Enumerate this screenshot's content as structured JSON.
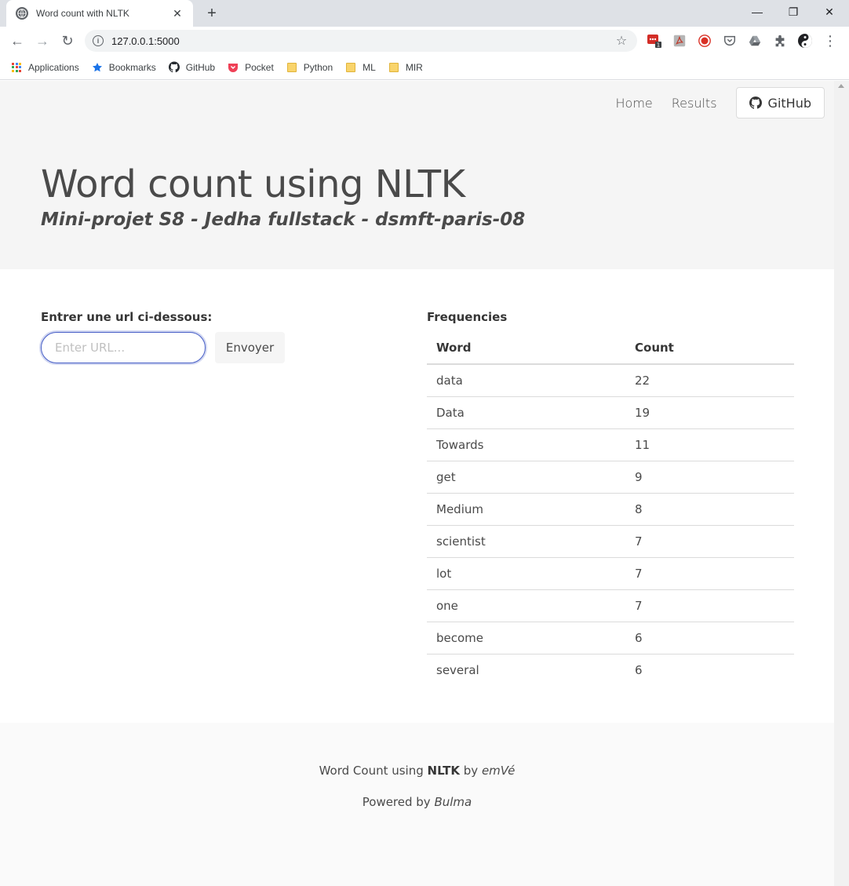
{
  "browser": {
    "tab_title": "Word count with NLTK",
    "tab_close": "✕",
    "new_tab": "+",
    "minimize": "—",
    "restore": "❐",
    "close": "✕",
    "back": "←",
    "forward": "→",
    "reload": "↻",
    "info": "i",
    "url": "127.0.0.1:5000",
    "star": "☆",
    "extension_badge": "1",
    "menu": "⋮",
    "bookmarks": [
      {
        "label": "Applications",
        "icon": "apps-grid-icon"
      },
      {
        "label": "Bookmarks",
        "icon": "star-icon"
      },
      {
        "label": "GitHub",
        "icon": "github-icon"
      },
      {
        "label": "Pocket",
        "icon": "pocket-icon"
      },
      {
        "label": "Python",
        "icon": "folder-icon"
      },
      {
        "label": "ML",
        "icon": "folder-icon"
      },
      {
        "label": "MIR",
        "icon": "folder-icon"
      }
    ]
  },
  "nav": {
    "home": "Home",
    "results": "Results",
    "github": "GitHub"
  },
  "hero": {
    "title": "Word count using NLTK",
    "subtitle": "Mini-projet S8 - Jedha fullstack - dsmft-paris-08"
  },
  "form": {
    "label": "Entrer une url ci-dessous:",
    "placeholder": "Enter URL...",
    "submit": "Envoyer"
  },
  "frequencies": {
    "title": "Frequencies",
    "headers": {
      "word": "Word",
      "count": "Count"
    },
    "rows": [
      {
        "word": "data",
        "count": "22"
      },
      {
        "word": "Data",
        "count": "19"
      },
      {
        "word": "Towards",
        "count": "11"
      },
      {
        "word": "get",
        "count": "9"
      },
      {
        "word": "Medium",
        "count": "8"
      },
      {
        "word": "scientist",
        "count": "7"
      },
      {
        "word": "lot",
        "count": "7"
      },
      {
        "word": "one",
        "count": "7"
      },
      {
        "word": "become",
        "count": "6"
      },
      {
        "word": "several",
        "count": "6"
      }
    ]
  },
  "footer": {
    "line1_prefix": "Word Count using ",
    "line1_bold": "NLTK",
    "line1_by": " by ",
    "line1_author": "emVé",
    "line2_prefix": "Powered by ",
    "line2_name": "Bulma"
  },
  "colors": {
    "hero_bg": "#f5f5f5",
    "footer_bg": "#fafafa",
    "input_focus": "#485fc7",
    "text": "#4a4a4a"
  }
}
